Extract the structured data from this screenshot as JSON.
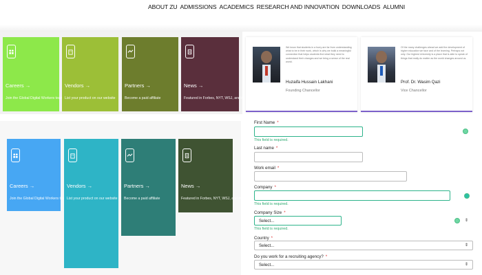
{
  "nav": [
    "ABOUT ZU",
    "ADMISSIONS",
    "ACADEMICS",
    "RESEARCH AND INNOVATION",
    "DOWNLOADS",
    "ALUMNI"
  ],
  "upper_tiles": [
    {
      "title": "Careers →",
      "desc": "Join the Global Digital Workers team in Pakistan",
      "color": "#8de84a",
      "icon": "team-icon"
    },
    {
      "title": "Vendors →",
      "desc": "List your product on our website",
      "color": "#9cbf37",
      "icon": "building-icon"
    },
    {
      "title": "Partners →",
      "desc": "Become a paid affiliate",
      "color": "#6d7d2d",
      "icon": "handshake-icon"
    },
    {
      "title": "News →",
      "desc": "Featured in Forbes, NYT, WSJ, and more",
      "color": "#5a2f3c",
      "icon": "document-icon"
    }
  ],
  "lower_tiles": [
    {
      "title": "Careers →",
      "desc": "Join the Global Digital Workers team in Austin",
      "color": "#47a7f3",
      "icon": "team-icon"
    },
    {
      "title": "Vendors →",
      "desc": "List your product on our website",
      "color": "#2eb4c6",
      "icon": "building-icon"
    },
    {
      "title": "Partners →",
      "desc": "Become a paid affiliate",
      "color": "#2e7e77",
      "icon": "handshake-icon"
    },
    {
      "title": "News →",
      "desc": "Featured in Forbes, NYT, WSJ, and more",
      "color": "#3f5332",
      "icon": "document-icon"
    }
  ],
  "profiles": [
    {
      "quote": "We know that students in a hurry are far from understanding what to be in their work, which is why we build a meaningful connection that helps students find what they need to understand their changes and we bring a sense of the real world.",
      "name": "Huzaifa Hussain Lakhani",
      "role": "Founding Chancellor"
    },
    {
      "quote": "Of the many challenges ahead we add the development of higher education we face and of the learning. Perhaps not only. Our highest University is a place that is able to speak of things that really do matter as the world changes around us.",
      "name": "Prof. Dr. Wasim Qazi",
      "role": "Vice Chancellor"
    }
  ],
  "form": {
    "first_name": {
      "label": "First Name",
      "error": "This field is required."
    },
    "last_name": {
      "label": "Last name"
    },
    "work_email": {
      "label": "Work email"
    },
    "company": {
      "label": "Company",
      "error": "This field is required."
    },
    "company_size": {
      "label": "Company Size",
      "value": "Select...",
      "error": "This field is required."
    },
    "country": {
      "label": "Country",
      "value": "Select..."
    },
    "recruiting": {
      "label": "Do you work for a recruiting agency?",
      "value": "Select..."
    },
    "required_mark": "*",
    "accent_color": "#2ca86e"
  }
}
